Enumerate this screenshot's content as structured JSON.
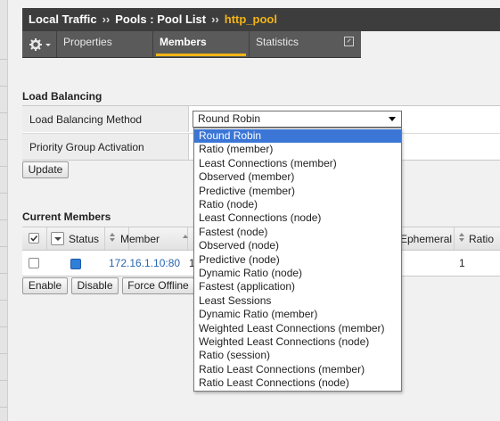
{
  "breadcrumb": {
    "section": "Local Traffic",
    "sep1": "››",
    "path": "Pools : Pool List",
    "sep2": "››",
    "pool": "http_pool"
  },
  "tabs": {
    "properties": "Properties",
    "members": "Members",
    "statistics": "Statistics"
  },
  "load_balancing": {
    "title": "Load Balancing",
    "method_label": "Load Balancing Method",
    "priority_label": "Priority Group Activation",
    "selected": "Round Robin",
    "update_label": "Update",
    "options": [
      "Round Robin",
      "Ratio (member)",
      "Least Connections (member)",
      "Observed (member)",
      "Predictive (member)",
      "Ratio (node)",
      "Least Connections (node)",
      "Fastest (node)",
      "Observed (node)",
      "Predictive (node)",
      "Dynamic Ratio (node)",
      "Fastest (application)",
      "Least Sessions",
      "Dynamic Ratio (member)",
      "Weighted Least Connections (member)",
      "Weighted Least Connections (node)",
      "Ratio (session)",
      "Ratio Least Connections (member)",
      "Ratio Least Connections (node)"
    ]
  },
  "members": {
    "title": "Current Members",
    "columns": {
      "status": "Status",
      "member": "Member",
      "ephemeral": "Ephemeral",
      "ratio": "Ratio"
    },
    "row": {
      "member": "172.16.1.10:80",
      "address_fragment": "1",
      "ratio": "1"
    },
    "buttons": {
      "enable": "Enable",
      "disable": "Disable",
      "force_offline": "Force Offline"
    }
  },
  "colors": {
    "accent": "#f3b416",
    "selection": "#3b76d6",
    "header_bg": "#3d3d3d"
  },
  "icons": {
    "gear": "gear-icon",
    "popout": "popout-icon",
    "status": "status-available-icon"
  }
}
